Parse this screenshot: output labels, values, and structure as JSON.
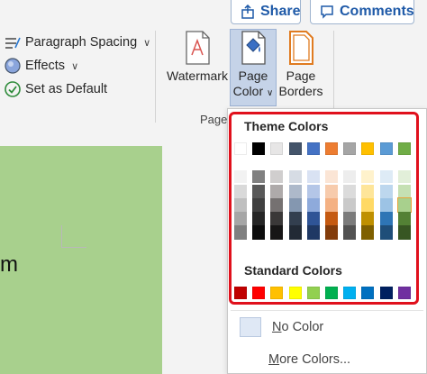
{
  "top_buttons": {
    "share": "Share",
    "comments": "Comments"
  },
  "ribbon": {
    "paragraph_spacing": "Paragraph Spacing",
    "effects": "Effects",
    "set_as_default": "Set as Default",
    "watermark": "Watermark",
    "page_color_line1": "Page",
    "page_color_line2": "Color",
    "page_borders_line1": "Page",
    "page_borders_line2": "Borders",
    "group_label": "Page"
  },
  "document": {
    "text": "m"
  },
  "page_color_menu": {
    "theme_colors_label": "Theme Colors",
    "standard_colors_label": "Standard Colors",
    "no_color_label": "No Color",
    "more_colors_label": "More Colors...",
    "theme_colors": [
      "#ffffff",
      "#000000",
      "#e7e6e6",
      "#44546a",
      "#4472c4",
      "#ed7d31",
      "#a5a5a5",
      "#ffc000",
      "#5b9bd5",
      "#70ad47"
    ],
    "theme_shades": [
      [
        "#f2f2f2",
        "#d9d9d9",
        "#bfbfbf",
        "#a6a6a6",
        "#808080"
      ],
      [
        "#808080",
        "#595959",
        "#404040",
        "#262626",
        "#0d0d0d"
      ],
      [
        "#d0cece",
        "#aeaaaa",
        "#757171",
        "#3a3838",
        "#171616"
      ],
      [
        "#d6dce4",
        "#adb9ca",
        "#8497b0",
        "#333f4f",
        "#222a35"
      ],
      [
        "#d9e2f3",
        "#b4c6e7",
        "#8eaadb",
        "#2f5496",
        "#1f3864"
      ],
      [
        "#fbe5d5",
        "#f7cbac",
        "#f4b183",
        "#c55a11",
        "#833c0b"
      ],
      [
        "#ededed",
        "#dbdbdb",
        "#c9c9c9",
        "#7b7b7b",
        "#525252"
      ],
      [
        "#fff2cc",
        "#fee599",
        "#ffd965",
        "#bf9000",
        "#7f6000"
      ],
      [
        "#deebf6",
        "#bdd7ee",
        "#9cc3e5",
        "#2e75b5",
        "#1f4e79"
      ],
      [
        "#e2efd9",
        "#c5e0b3",
        "#a8d08d",
        "#538135",
        "#375623"
      ]
    ],
    "selected_shade": {
      "column": 9,
      "row": 2
    },
    "standard_colors": [
      "#c00000",
      "#ff0000",
      "#ffc000",
      "#ffff00",
      "#92d050",
      "#00b050",
      "#00b0f0",
      "#0070c0",
      "#002060",
      "#7030a0"
    ]
  }
}
